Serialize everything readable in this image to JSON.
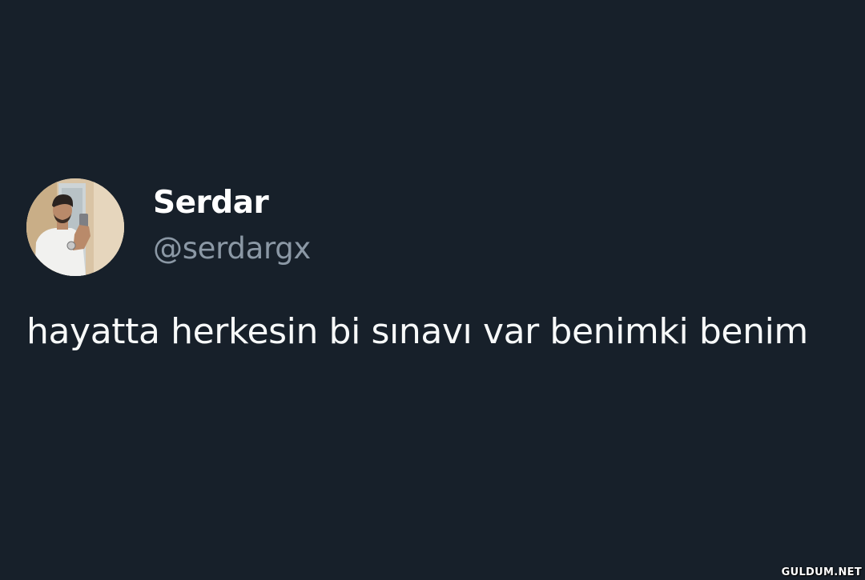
{
  "tweet": {
    "author": {
      "display_name": "Serdar",
      "handle": "@serdargx"
    },
    "text": "hayatta herkesin bi sınavı var benimki benim"
  },
  "watermark": "GULDUM.NET",
  "colors": {
    "background": "#17202a",
    "display_name": "#ffffff",
    "handle": "#8b98a5",
    "text": "#f7f9f9"
  }
}
